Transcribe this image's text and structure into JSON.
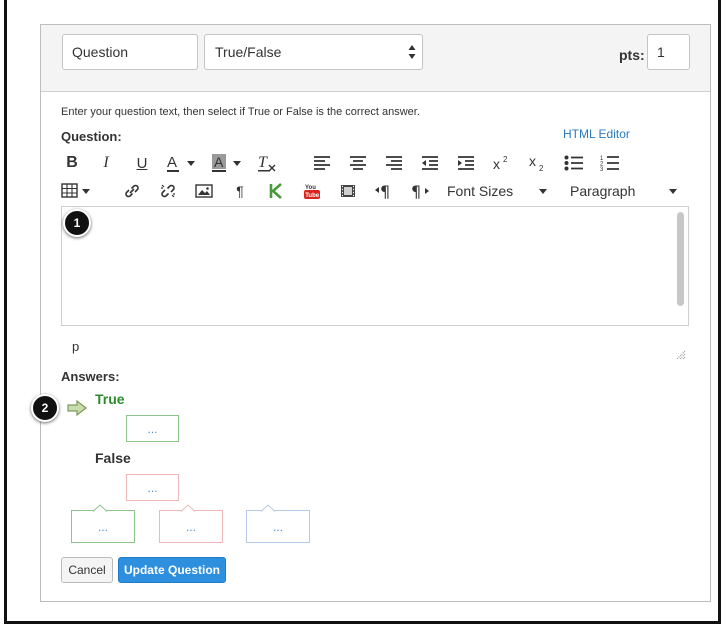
{
  "header": {
    "title_value": "Question",
    "type_value": "True/False",
    "pts_label": "pts:",
    "pts_value": "1"
  },
  "instructions": "Enter your question text, then select if True or False is the correct answer.",
  "question_label": "Question:",
  "html_editor_label": "HTML Editor",
  "toolbar": {
    "row1": [
      {
        "name": "bold-button",
        "glyph": "B"
      },
      {
        "name": "italic-button",
        "glyph": "I"
      },
      {
        "name": "underline-button",
        "glyph": "U"
      },
      {
        "name": "text-color-button",
        "glyph": "A"
      },
      {
        "name": "background-color-button",
        "glyph": "A"
      },
      {
        "name": "clear-formatting-button",
        "glyph": "T"
      },
      {
        "name": "align-left-button",
        "glyph": "≡"
      },
      {
        "name": "align-center-button",
        "glyph": "≡"
      },
      {
        "name": "align-right-button",
        "glyph": "≡"
      },
      {
        "name": "outdent-button",
        "glyph": "≡"
      },
      {
        "name": "indent-button",
        "glyph": "≡"
      },
      {
        "name": "superscript-button",
        "glyph": "x²"
      },
      {
        "name": "subscript-button",
        "glyph": "x₂"
      },
      {
        "name": "bullet-list-button",
        "glyph": "•"
      },
      {
        "name": "numbered-list-button",
        "glyph": "1"
      }
    ],
    "font_sizes_label": "Font Sizes",
    "paragraph_label": "Paragraph"
  },
  "status_path": "p",
  "answers_label": "Answers:",
  "answers": [
    {
      "label": "True",
      "comment": "..."
    },
    {
      "label": "False",
      "comment": "..."
    }
  ],
  "general_comments": [
    "...",
    "...",
    "..."
  ],
  "badges": [
    "1",
    "2"
  ],
  "buttons": {
    "cancel": "Cancel",
    "update": "Update Question"
  },
  "colors": {
    "primary": "#2d8fde",
    "correct": "#2d8a2d",
    "link": "#2a7bbf"
  }
}
